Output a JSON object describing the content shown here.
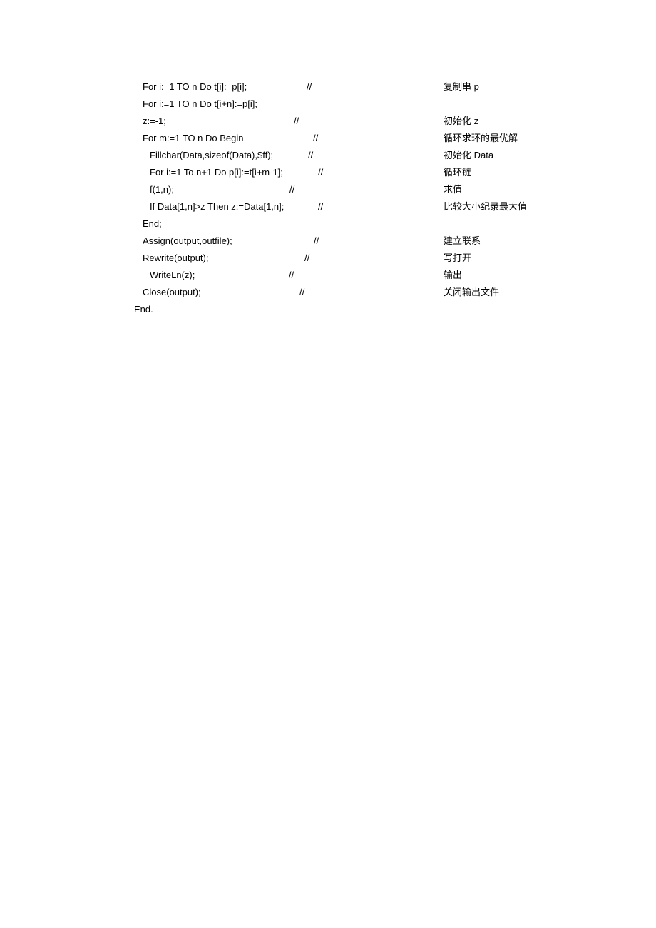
{
  "lines": [
    {
      "indent": "c2",
      "code": "For i:=1 TO n Do t[i]:=p[i];",
      "sl": 430,
      "cmt_pre": "复制串",
      "cmt_mono": "p"
    },
    {
      "indent": "c2",
      "code": "For i:=1 TO n Do t[i+n]:=p[i];",
      "sl": null,
      "cmt_pre": "",
      "cmt_mono": ""
    },
    {
      "indent": "c2",
      "code": "z:=-1;",
      "sl": 412,
      "cmt_pre": "初始化",
      "cmt_mono": "z"
    },
    {
      "indent": "c2",
      "code": "For m:=1 TO n Do Begin",
      "sl": 439,
      "cmt_pre": "循环求环的最优解",
      "cmt_mono": ""
    },
    {
      "indent": "c3",
      "code": "Fillchar(Data,sizeof(Data),$ff);",
      "sl": 432,
      "cmt_pre": "初始化",
      "cmt_mono": "Data"
    },
    {
      "indent": "c3",
      "code": "For i:=1 To n+1 Do p[i]:=t[i+m-1];",
      "sl": 446,
      "cmt_pre": "循环链",
      "cmt_mono": ""
    },
    {
      "indent": "c3",
      "code": "f(1,n);",
      "sl": 406,
      "cmt_pre": "求值",
      "cmt_mono": ""
    },
    {
      "indent": "c3",
      "code": "If Data[1,n]>z Then z:=Data[1,n];",
      "sl": 446,
      "cmt_pre": "比较大小纪录最大值",
      "cmt_mono": ""
    },
    {
      "indent": "c2",
      "code": "End;",
      "sl": null,
      "cmt_pre": "",
      "cmt_mono": ""
    },
    {
      "indent": "c2",
      "code": "Assign(output,outfile);",
      "sl": 440,
      "cmt_pre": "建立联系",
      "cmt_mono": ""
    },
    {
      "indent": "c2",
      "code": "Rewrite(output);",
      "sl": 427,
      "cmt_pre": "写打开",
      "cmt_mono": ""
    },
    {
      "indent": "c4",
      "code": "WriteLn(z);",
      "sl": 405,
      "cmt_pre": "输出",
      "cmt_mono": ""
    },
    {
      "indent": "c2",
      "code": "Close(output);",
      "sl": 420,
      "cmt_pre": "关闭输出文件",
      "cmt_mono": ""
    },
    {
      "indent": "c1",
      "code": "End.",
      "sl": null,
      "cmt_pre": "",
      "cmt_mono": ""
    }
  ],
  "slash": "//"
}
